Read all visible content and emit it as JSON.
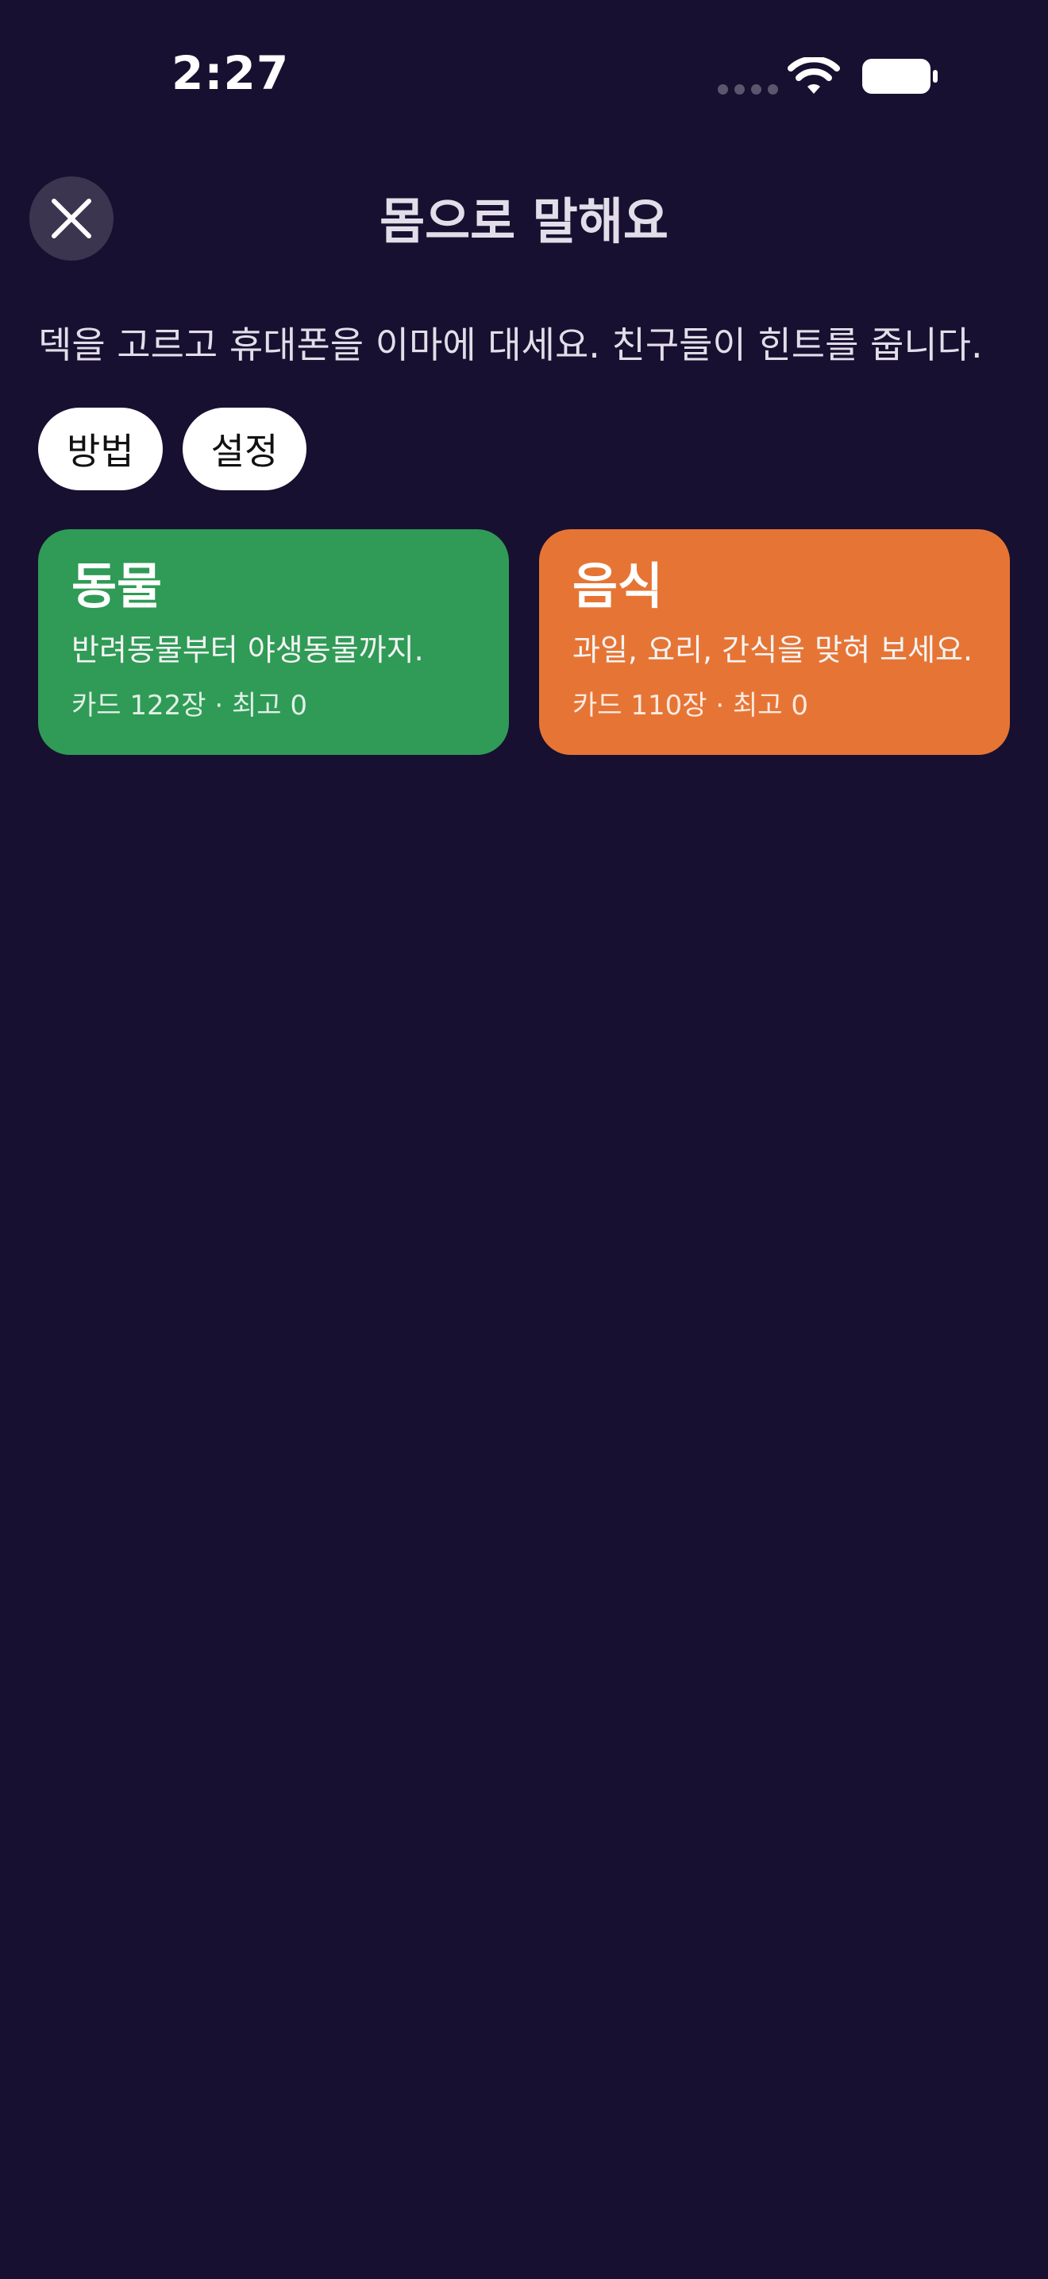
{
  "colors": {
    "background": "#181030",
    "close_button_bg": "#3b3550",
    "pill_bg": "#ffffff",
    "title_text": "#e2dee9"
  },
  "status_bar": {
    "time": "2:27",
    "icons": [
      "cellular-signal-icon",
      "wifi-icon",
      "battery-icon"
    ]
  },
  "header": {
    "close_icon": "close-icon",
    "title": "몸으로 말해요"
  },
  "instructions": "덱을 고르고 휴대폰을 이마에 대세요. 친구들이 힌트를 줍니다.",
  "buttons": {
    "how_to": "방법",
    "settings": "설정"
  },
  "decks": [
    {
      "title": "동물",
      "description": "반려동물부터 야생동물까지.",
      "meta": "카드 122장 · 최고 0",
      "color": "#2f9b56"
    },
    {
      "title": "음식",
      "description": "과일, 요리, 간식을 맞혀 보세요.",
      "meta": "카드 110장 · 최고 0",
      "color": "#e67535"
    }
  ]
}
